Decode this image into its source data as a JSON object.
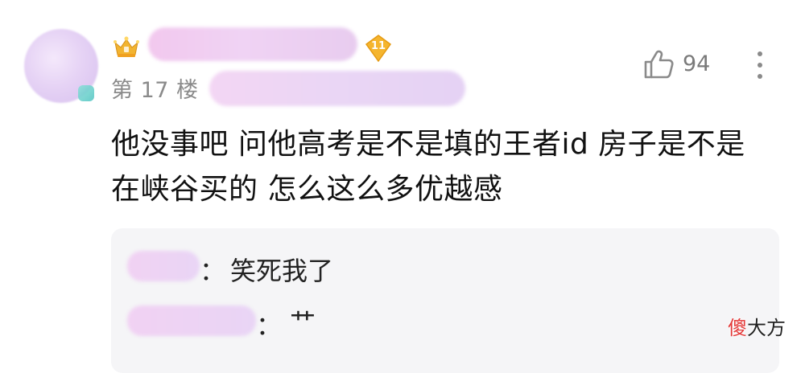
{
  "comment": {
    "floor": "第 17 楼",
    "level": "11",
    "like_count": "94",
    "text": "他没事吧 问他高考是不是填的王者id 房子是不是在峡谷买的 怎么这么多优越感"
  },
  "replies": [
    {
      "separator": "：",
      "text": "笑死我了"
    },
    {
      "separator": "：",
      "text": "艹"
    }
  ],
  "watermark": {
    "first": "傻",
    "rest": "大方"
  },
  "icons": {
    "crown": "crown-icon",
    "level": "level-diamond-icon",
    "like": "thumbs-up-icon",
    "more": "more-vertical-icon"
  },
  "colors": {
    "level_badge": "#f5b52e",
    "crown": "#f2b431",
    "watermark_accent": "#e43a3a"
  }
}
